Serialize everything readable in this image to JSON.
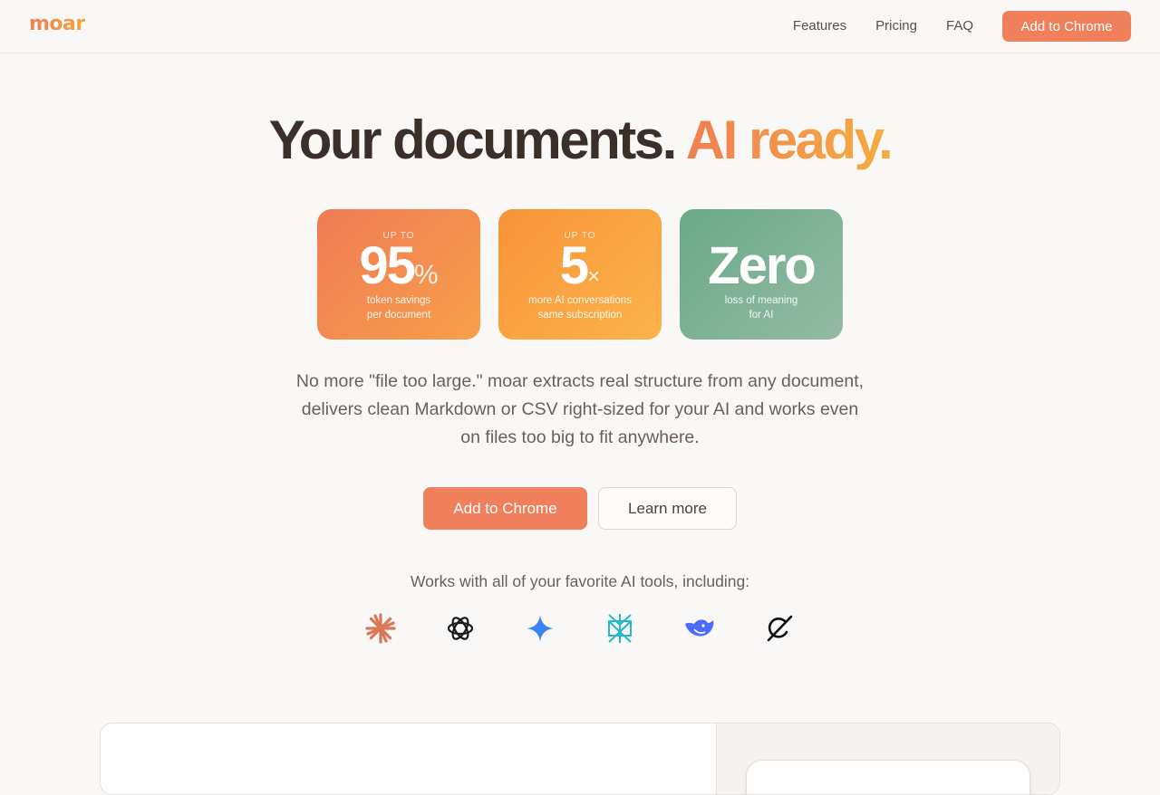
{
  "nav": {
    "logo": "moar",
    "links": [
      "Features",
      "Pricing",
      "FAQ"
    ],
    "cta": "Add to Chrome"
  },
  "hero": {
    "title_main": "Your documents.",
    "title_accent": "AI ready.",
    "description": "No more \"file too large.\" moar extracts real structure from any document, delivers clean Markdown or CSV right-sized for your AI and works even on files too big to fit anywhere.",
    "primary_cta": "Add to Chrome",
    "secondary_cta": "Learn more"
  },
  "stats": [
    {
      "pre": "UP TO",
      "value": "95",
      "unit": "%",
      "line1": "token savings",
      "line2": "per document",
      "color": "#f07b55"
    },
    {
      "pre": "UP TO",
      "value": "5",
      "unit": "×",
      "line1": "more AI conversations",
      "line2": "same subscription",
      "color": "#f8933a"
    },
    {
      "pre": "",
      "value": "Zero",
      "unit": "",
      "line1": "loss of meaning",
      "line2": "for AI",
      "color": "#6aa988"
    }
  ],
  "tools": {
    "label": "Works with all of your favorite AI tools, including:",
    "icons": [
      "claude-icon",
      "openai-icon",
      "gemini-icon",
      "perplexity-icon",
      "deepseek-icon",
      "grok-icon"
    ]
  },
  "colors": {
    "accent": "#f07f5c",
    "accent_gradient_end": "#f6ad3e",
    "background": "#faf8f6",
    "text": "#3a2f29"
  }
}
